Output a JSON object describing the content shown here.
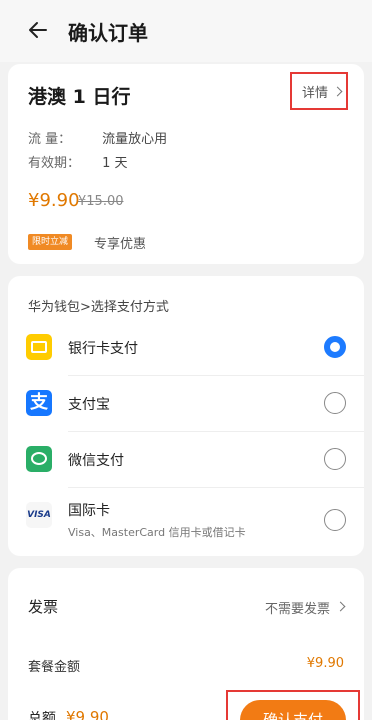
{
  "header": {
    "title": "确认订单"
  },
  "product": {
    "name": "港澳 1 日行",
    "detail_label": "详情",
    "flow_key": "流    量：",
    "flow_value": "流量放心用",
    "validity_key": "有效期：",
    "validity_value": "1 天",
    "price": "¥9.90",
    "old_price": "¥15.00",
    "tag": "限时立减",
    "tag_text": "专享优惠"
  },
  "payment": {
    "header": "华为钱包>选择支付方式",
    "methods": [
      {
        "label": "银行卡支付",
        "selected": true
      },
      {
        "label": "支付宝",
        "selected": false
      },
      {
        "label": "微信支付",
        "selected": false
      },
      {
        "label": "国际卡",
        "sub": "Visa、MasterCard 信用卡或借记卡",
        "icon_text": "VISA",
        "selected": false
      }
    ]
  },
  "summary": {
    "invoice_label": "发票",
    "invoice_value": "不需要发票",
    "set_amount_label": "套餐金额",
    "set_amount_value": "¥9.90",
    "total_label": "总额",
    "total_value": "¥9.90",
    "confirm_label": "确认支付"
  },
  "colors": {
    "accent": "#f27b14",
    "price": "#e07800",
    "radio": "#1d7bff",
    "highlight": "#e53935"
  }
}
